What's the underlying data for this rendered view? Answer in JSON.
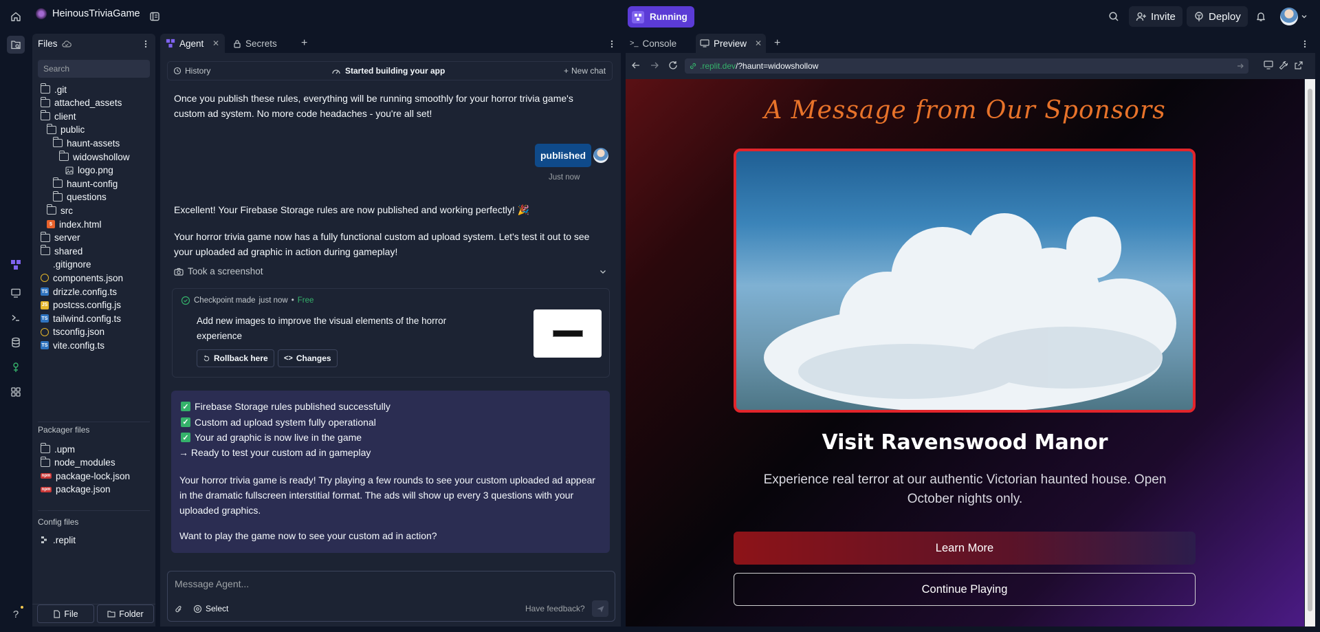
{
  "topbar": {
    "project_name": "HeinousTriviaGame",
    "run_status": "Running",
    "invite_label": "Invite",
    "deploy_label": "Deploy"
  },
  "files": {
    "title": "Files",
    "search_placeholder": "Search",
    "tree": [
      {
        "name": ".git",
        "type": "folder",
        "depth": 0
      },
      {
        "name": "attached_assets",
        "type": "folder",
        "depth": 0
      },
      {
        "name": "client",
        "type": "folder",
        "depth": 0
      },
      {
        "name": "public",
        "type": "folder",
        "depth": 1
      },
      {
        "name": "haunt-assets",
        "type": "folder",
        "depth": 2
      },
      {
        "name": "widowshollow",
        "type": "folder",
        "depth": 3
      },
      {
        "name": "logo.png",
        "type": "image",
        "depth": 4
      },
      {
        "name": "haunt-config",
        "type": "folder",
        "depth": 2
      },
      {
        "name": "questions",
        "type": "folder",
        "depth": 2
      },
      {
        "name": "src",
        "type": "folder",
        "depth": 1
      },
      {
        "name": "index.html",
        "type": "html",
        "depth": 1
      },
      {
        "name": "server",
        "type": "folder",
        "depth": 0
      },
      {
        "name": "shared",
        "type": "folder",
        "depth": 0
      },
      {
        "name": ".gitignore",
        "type": "plain",
        "depth": 0
      },
      {
        "name": "components.json",
        "type": "json",
        "depth": 0
      },
      {
        "name": "drizzle.config.ts",
        "type": "ts",
        "depth": 0
      },
      {
        "name": "postcss.config.js",
        "type": "js",
        "depth": 0
      },
      {
        "name": "tailwind.config.ts",
        "type": "ts",
        "depth": 0
      },
      {
        "name": "tsconfig.json",
        "type": "json",
        "depth": 0
      },
      {
        "name": "vite.config.ts",
        "type": "ts",
        "depth": 0
      }
    ],
    "packager_title": "Packager files",
    "packager": [
      {
        "name": ".upm",
        "type": "folder"
      },
      {
        "name": "node_modules",
        "type": "folder"
      },
      {
        "name": "package-lock.json",
        "type": "npm"
      },
      {
        "name": "package.json",
        "type": "npm"
      }
    ],
    "config_title": "Config files",
    "config": [
      {
        "name": ".replit",
        "type": "replit"
      }
    ],
    "new_file_label": "File",
    "new_folder_label": "Folder"
  },
  "agent": {
    "tabs": [
      {
        "label": "Agent"
      },
      {
        "label": "Secrets"
      }
    ],
    "history_label": "History",
    "status_title": "Started building your app",
    "new_chat_label": "New chat",
    "msg1": "Once you publish these rules, everything will be running smoothly for your horror trivia game's custom ad system. No more code headaches - you're all set!",
    "user_msg": "published",
    "user_time": "Just now",
    "msg2": "Excellent! Your Firebase Storage rules are now published and working perfectly! 🎉",
    "msg3": "Your horror trivia game now has a fully functional custom ad upload system. Let's test it out to see your uploaded ad graphic in action during gameplay!",
    "screenshot_label": "Took a screenshot",
    "checkpoint": {
      "label": "Checkpoint made",
      "time": "just now",
      "price": "Free",
      "description": "Add new images to improve the visual elements of the horror experience",
      "rollback_label": "Rollback here",
      "changes_label": "Changes"
    },
    "summary": {
      "checks": [
        "Firebase Storage rules published successfully",
        "Custom ad upload system fully operational",
        "Your ad graphic is now live in the game"
      ],
      "arrow_item": "→ Ready to test your custom ad in gameplay",
      "para": "Your horror trivia game is ready! Try playing a few rounds to see your custom uploaded ad appear in the dramatic fullscreen interstitial format. The ads will show up every 3 questions with your uploaded graphics.",
      "question": "Want to play the game now to see your custom ad in action?"
    },
    "input_placeholder": "Message Agent...",
    "select_label": "Select",
    "feedback_label": "Have feedback?"
  },
  "preview": {
    "tabs": [
      {
        "label": "Console"
      },
      {
        "label": "Preview"
      }
    ],
    "url_domain": ".replit.dev",
    "url_path": "/?haunt=widowshollow",
    "site": {
      "heading": "A Message from Our Sponsors",
      "ad_title": "Visit Ravenswood Manor",
      "ad_description": "Experience real terror at our authentic Victorian haunted house. Open October nights only.",
      "learn_more_label": "Learn More",
      "continue_label": "Continue Playing"
    }
  },
  "colors": {
    "accent_purple": "#5b3bd6",
    "user_bubble": "#0f4a8a",
    "ad_border": "#e2252b",
    "heading_orange": "#e8732a",
    "green_check": "#35b26b"
  }
}
